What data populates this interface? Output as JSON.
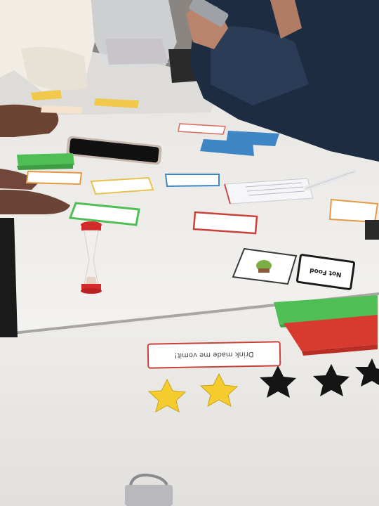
{
  "photo": {
    "colors": {
      "table": "#ecebe8",
      "green_card": "#4fbf55",
      "red_card": "#d73b2f",
      "blue_card": "#3e86c4",
      "yellow_card": "#f2c84b",
      "gold_star": "#f4cc2e",
      "black_star": "#151515",
      "sand_timer_cap": "#d52a2a",
      "denim": "#1c2a3e"
    },
    "cards": {
      "bottom_red_text": "Drink made me vomit!",
      "black_border_card_text": "Not Food"
    },
    "counts": {
      "gold_stars": 2,
      "black_stars": 3
    }
  }
}
